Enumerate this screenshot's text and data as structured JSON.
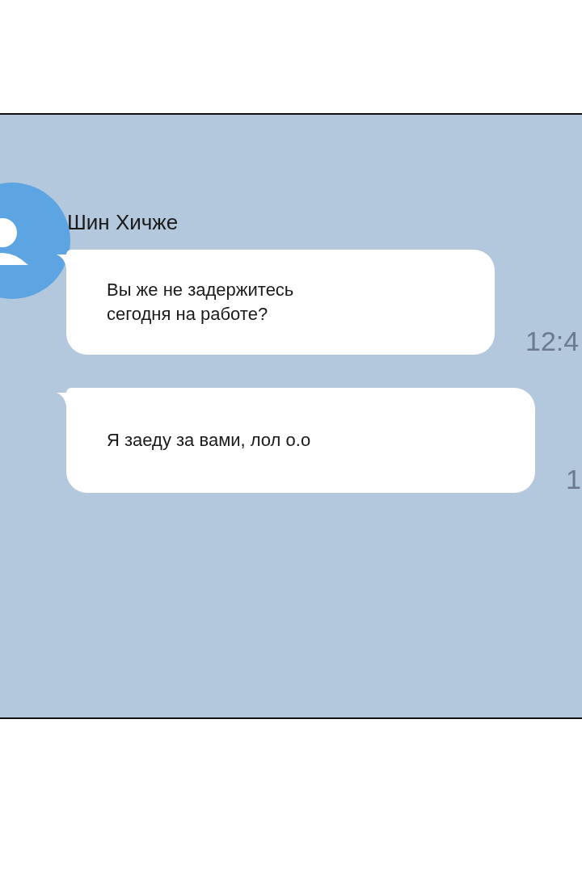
{
  "contact": {
    "name": "Шин Хичже"
  },
  "messages": [
    {
      "text": "Вы же не задержитесь сегодня на работе?",
      "time": "12:4"
    },
    {
      "text": "Я заеду за вами, лол о.о",
      "time": "1"
    }
  ]
}
